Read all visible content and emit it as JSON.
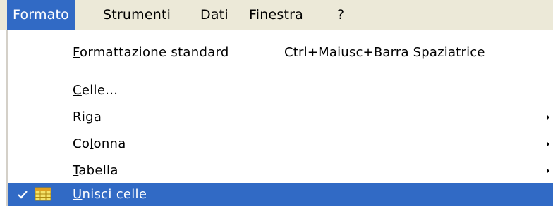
{
  "menubar": {
    "items": [
      {
        "pre": "F",
        "mn": "o",
        "post": "rmato"
      },
      {
        "pre": "",
        "mn": "S",
        "post": "trumenti"
      },
      {
        "pre": "",
        "mn": "D",
        "post": "ati"
      },
      {
        "pre": "Fi",
        "mn": "n",
        "post": "estra"
      },
      {
        "pre": "",
        "mn": "?",
        "post": ""
      }
    ]
  },
  "menu": {
    "items": [
      {
        "pre": "",
        "mn": "F",
        "post": "ormattazione standard",
        "shortcut": "Ctrl+Maiusc+Barra Spaziatrice"
      },
      {
        "pre": "",
        "mn": "C",
        "post": "elle..."
      },
      {
        "pre": "",
        "mn": "R",
        "post": "iga"
      },
      {
        "pre": "Co",
        "mn": "l",
        "post": "onna"
      },
      {
        "pre": "",
        "mn": "T",
        "post": "abella"
      },
      {
        "pre": "",
        "mn": "U",
        "post": "nisci celle"
      }
    ]
  },
  "colors": {
    "highlight": "#316ac5",
    "menubar_bg": "#ece9d8"
  }
}
